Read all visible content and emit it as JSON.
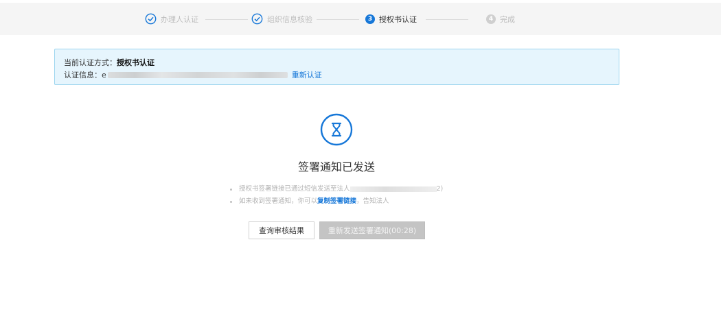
{
  "steps": [
    {
      "label": "办理人认证",
      "state": "done"
    },
    {
      "label": "组织信息核验",
      "state": "done"
    },
    {
      "label": "授权书认证",
      "state": "active",
      "number": "3"
    },
    {
      "label": "完成",
      "state": "todo",
      "number": "4"
    }
  ],
  "notice": {
    "method_label": "当前认证方式：",
    "method_value": "授权书认证",
    "info_label": "认证信息：",
    "info_prefix": "e",
    "reauth_link": "重新认证"
  },
  "status": {
    "icon": "hourglass-icon",
    "title": "签署通知已发送"
  },
  "tips": {
    "line1_prefix": "授权书签署链接已通过短信发送至法人",
    "line1_suffix": "2)",
    "line2_prefix": "如未收到签署通知，你可以",
    "line2_link": "复制签署链接",
    "line2_suffix": "，告知法人"
  },
  "buttons": {
    "query": "查询审核结果",
    "resend": "重新发送签署通知(00:28)"
  },
  "colors": {
    "accent": "#1677d8",
    "notice_bg": "#e6f5fd",
    "notice_border": "#9dd5ef",
    "disabled_button": "#c4c4c4"
  }
}
